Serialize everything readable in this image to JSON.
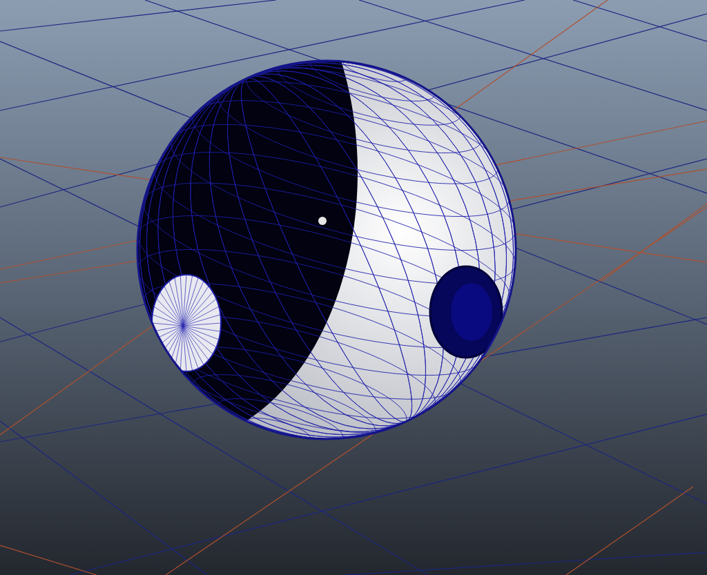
{
  "viewport": {
    "objects": [
      {
        "kind": "wireframe-sphere"
      }
    ]
  }
}
